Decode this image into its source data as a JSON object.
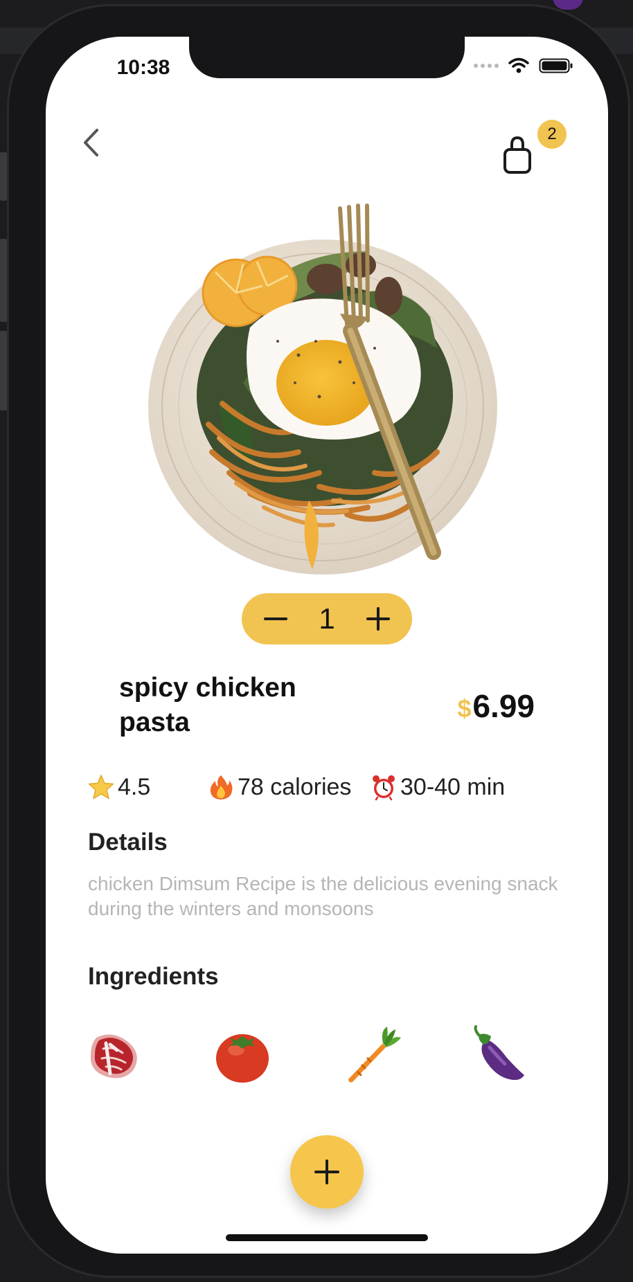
{
  "status_bar": {
    "time": "10:38"
  },
  "header": {
    "back_icon": "chevron-left-icon",
    "cart_icon": "shopping-bag-icon",
    "cart_count": "2"
  },
  "product": {
    "image_name": "pasta-plate-image",
    "quantity": "1",
    "name_line1": "spicy chicken",
    "name_line2": "pasta",
    "price_currency": "$",
    "price_value": "6.99"
  },
  "info": [
    {
      "icon": "star-icon",
      "text": "4.5"
    },
    {
      "icon": "fire-icon",
      "text": "78 calories"
    },
    {
      "icon": "alarm-clock-icon",
      "text": "30-40 min"
    }
  ],
  "details": {
    "title": "Details",
    "description": "chicken Dimsum Recipe is the delicious evening snack during the winters and monsoons"
  },
  "ingredients": {
    "title": "Ingredients",
    "items": [
      "steak-icon",
      "tomato-icon",
      "carrot-icon",
      "eggplant-icon"
    ]
  },
  "colors": {
    "accent": "#f1c350",
    "muted_text": "#b5b5b5"
  }
}
